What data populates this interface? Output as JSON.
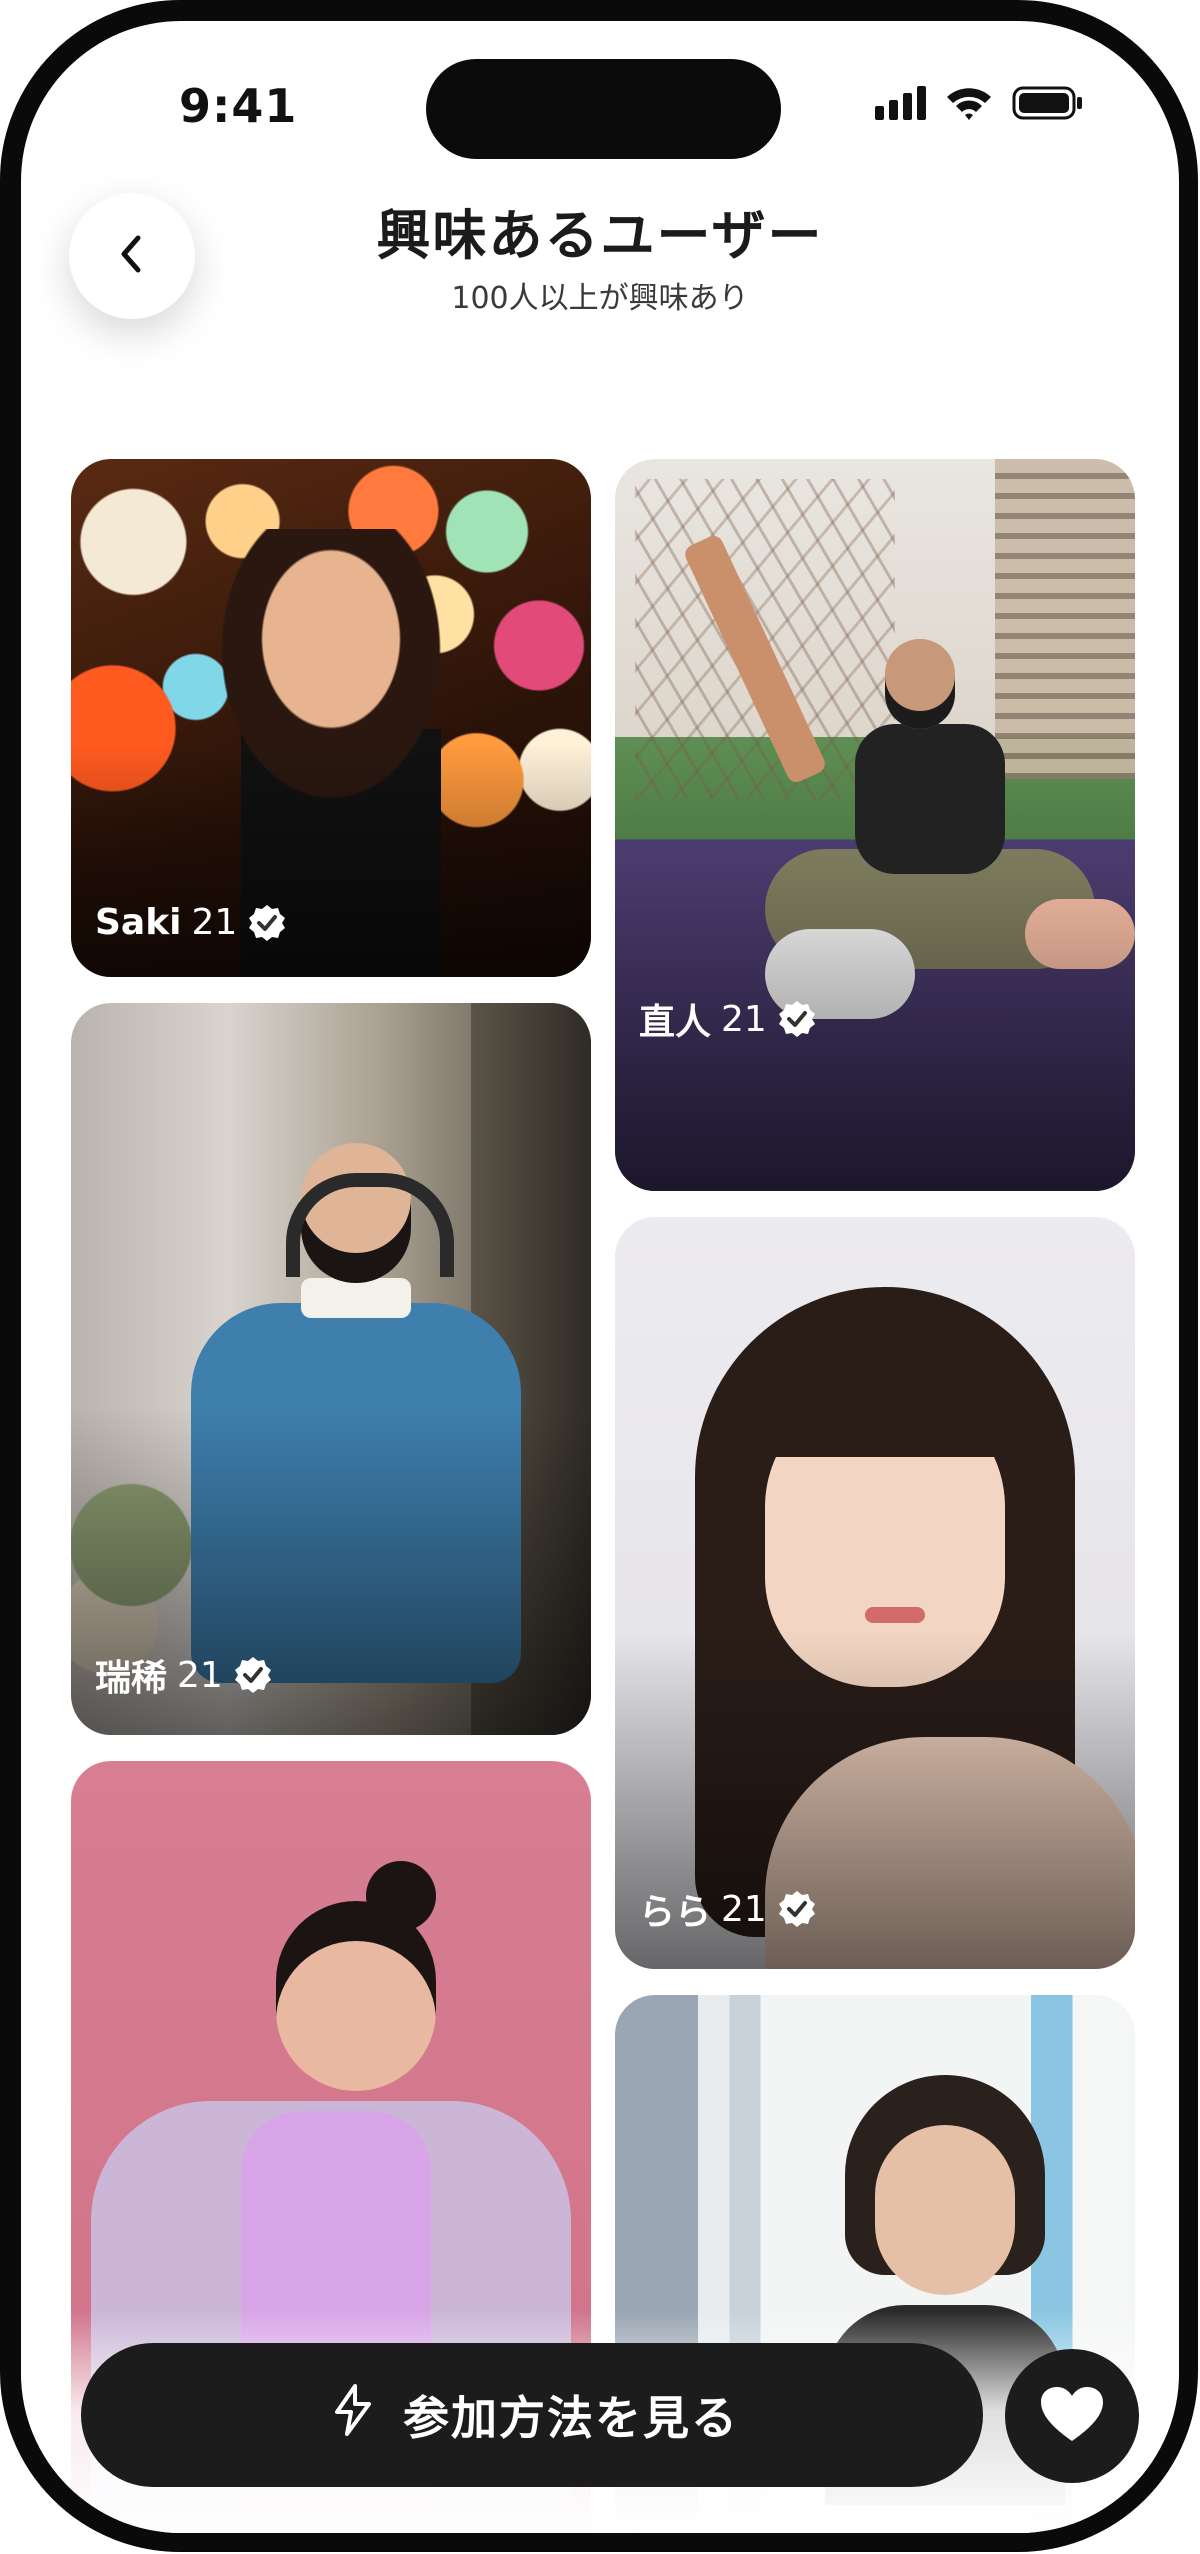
{
  "status_bar": {
    "time": "9:41",
    "icons": [
      "signal-icon",
      "wifi-icon",
      "battery-icon"
    ]
  },
  "header": {
    "back_icon": "chevron-left-icon",
    "title": "興味あるユーザー",
    "subtitle": "100人以上が興味あり"
  },
  "users": [
    {
      "name": "Saki",
      "age": "21",
      "verified": true
    },
    {
      "name": "直人",
      "age": "21",
      "verified": true
    },
    {
      "name": "瑞稀",
      "age": "21",
      "verified": true
    },
    {
      "name": "らら",
      "age": "21",
      "verified": true
    }
  ],
  "footer": {
    "join_label": "参加方法を見る",
    "join_icon": "sparkle-icon",
    "heart_icon": "heart-icon"
  },
  "colors": {
    "button_bg": "#1c1c1c",
    "text_primary": "#1b1b1b",
    "background": "#ffffff"
  }
}
